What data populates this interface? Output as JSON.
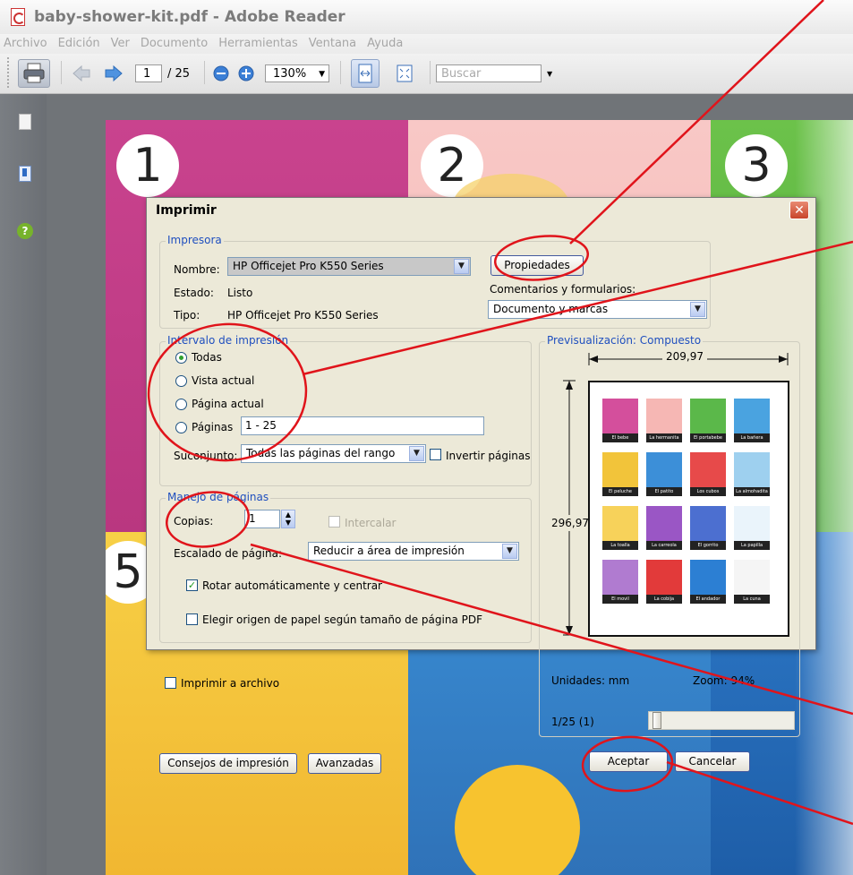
{
  "window": {
    "title": "baby-shower-kit.pdf - Adobe Reader"
  },
  "menubar": [
    "Archivo",
    "Edición",
    "Ver",
    "Documento",
    "Herramientas",
    "Ventana",
    "Ayuda"
  ],
  "toolbar": {
    "page_current": "1",
    "page_total": "/ 25",
    "zoom": "130%",
    "search_placeholder": "Buscar"
  },
  "document": {
    "panel_numbers": [
      "1",
      "2",
      "3",
      "5"
    ]
  },
  "dialog": {
    "title": "Imprimir",
    "printer": {
      "legend": "Impresora",
      "name_label": "Nombre:",
      "name_value": "HP Officejet Pro K550 Series",
      "status_label": "Estado:",
      "status_value": "Listo",
      "type_label": "Tipo:",
      "type_value": "HP Officejet Pro K550 Series",
      "properties_button": "Propiedades",
      "comments_label": "Comentarios y formularios:",
      "comments_value": "Documento y marcas"
    },
    "range": {
      "legend": "Intervalo de impresión",
      "all": "Todas",
      "current_view": "Vista actual",
      "current_page": "Página actual",
      "pages": "Páginas",
      "pages_value": "1 - 25",
      "subset_label": "Suconjunto:",
      "subset_value": "Todas las páginas del rango",
      "reverse": "Invertir páginas"
    },
    "handling": {
      "legend": "Manejo de páginas",
      "copies_label": "Copias:",
      "copies_value": "1",
      "collate": "Intercalar",
      "scaling_label": "Escalado de página:",
      "scaling_value": "Reducir a área de impresión",
      "auto_rotate": "Rotar automáticamente y centrar",
      "paper_source": "Elegir origen de papel según tamaño de página PDF"
    },
    "print_to_file": "Imprimir a archivo",
    "preview": {
      "legend": "Previsualización: Compuesto",
      "width": "209,97",
      "height": "296,97",
      "units": "Unidades: mm",
      "zoom": "Zoom: 94%",
      "page_indicator": "1/25 (1)",
      "slider_fraction": 0.0
    },
    "buttons": {
      "tips": "Consejos de impresión",
      "advanced": "Avanzadas",
      "ok": "Aceptar",
      "cancel": "Cancelar"
    },
    "thumb_captions": [
      "El bebe",
      "La hermanita",
      "El portabebe",
      "La bañera",
      "El peluche",
      "El patito",
      "Los cubos",
      "La almohadita",
      "La toalla",
      "La carreola",
      "El gorrito",
      "La papilla",
      "El movil",
      "La cobija",
      "El andador",
      "La cuna"
    ]
  },
  "colors": {
    "annotation": "#e0141b",
    "legend_blue": "#1f4fbf",
    "dialog_bg": "#ece9d8"
  }
}
